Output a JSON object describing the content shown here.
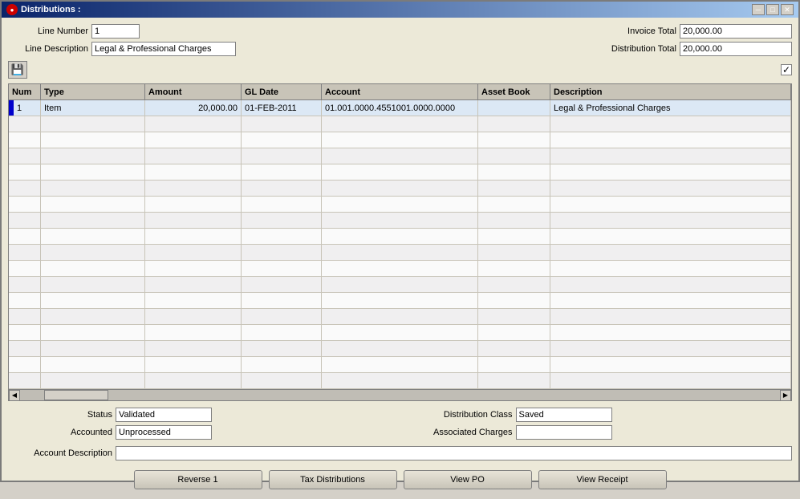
{
  "window": {
    "title": "Distributions :",
    "title_icon": "●"
  },
  "title_controls": {
    "minimize": "─",
    "maximize": "□",
    "close": "✕"
  },
  "header": {
    "line_number_label": "Line Number",
    "line_number_value": "1",
    "line_desc_label": "Line Description",
    "line_desc_value": "Legal & Professional Charges",
    "invoice_total_label": "Invoice Total",
    "invoice_total_value": "20,000.00",
    "distribution_total_label": "Distribution Total",
    "distribution_total_value": "20,000.00"
  },
  "toolbar": {
    "save_icon": "💾",
    "check_icon": "✓"
  },
  "table": {
    "columns": [
      {
        "key": "num",
        "label": "Num"
      },
      {
        "key": "type",
        "label": "Type"
      },
      {
        "key": "amount",
        "label": "Amount"
      },
      {
        "key": "gl_date",
        "label": "GL Date"
      },
      {
        "key": "account",
        "label": "Account"
      },
      {
        "key": "asset_book",
        "label": "Asset Book"
      },
      {
        "key": "description",
        "label": "Description"
      }
    ],
    "rows": [
      {
        "num": "1",
        "type": "Item",
        "amount": "20,000.00",
        "gl_date": "01-FEB-2011",
        "account": "01.001.0000.4551001.0000.0000",
        "asset_book": "",
        "description": "Legal & Professional Charges"
      }
    ],
    "empty_rows": 18
  },
  "status": {
    "status_label": "Status",
    "status_value": "Validated",
    "accounted_label": "Accounted",
    "accounted_value": "Unprocessed",
    "account_desc_label": "Account Description",
    "account_desc_value": "",
    "dist_class_label": "Distribution Class",
    "dist_class_value": "Saved",
    "assoc_charges_label": "Associated Charges",
    "assoc_charges_value": ""
  },
  "buttons": {
    "reverse": "Reverse 1",
    "tax_dist": "Tax Distributions",
    "view_po": "View PO",
    "view_receipt": "View Receipt"
  }
}
